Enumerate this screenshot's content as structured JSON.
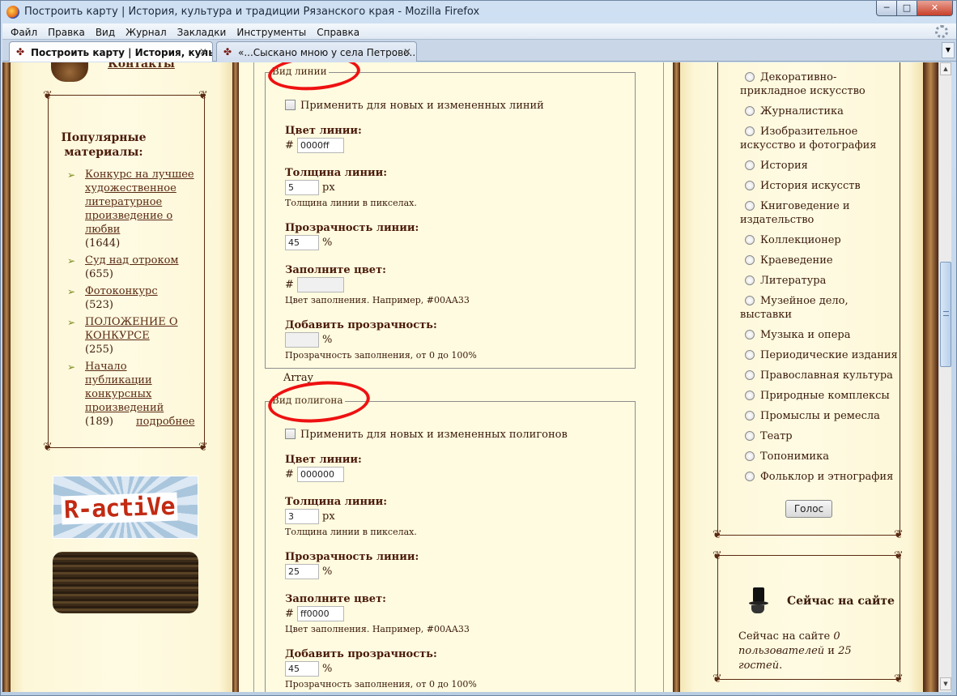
{
  "window": {
    "title": "Построить карту | История, культура и традиции Рязанского края - Mozilla Firefox",
    "min_label": "─",
    "max_label": "□",
    "close_label": "✕"
  },
  "menu": [
    "Файл",
    "Правка",
    "Вид",
    "Журнал",
    "Закладки",
    "Инструменты",
    "Справка"
  ],
  "tabs": [
    {
      "label": "Построить карту | История, куль...",
      "active": true
    },
    {
      "label": "«...Сыскано мною у села Петрово...",
      "active": false
    }
  ],
  "left": {
    "contacts": "Контакты",
    "popular_title": "Популярные материалы:",
    "popular_items": [
      {
        "title": "Конкурс на лучшее художественное литературное произведение о любви",
        "count": "(1644)"
      },
      {
        "title": "Суд над отроком",
        "count": "(655)"
      },
      {
        "title": "Фотоконкурс",
        "count": "(523)"
      },
      {
        "title": "ПОЛОЖЕНИЕ О КОНКУРСЕ",
        "count": "(255)"
      },
      {
        "title": "Начало публикации конкурсных произведений",
        "count": "(189)"
      }
    ],
    "more": "подробнее",
    "banner_text": "R-actiVe"
  },
  "line_style": {
    "legend": "Вид линии",
    "apply_label": "Применить для новых и измененных линий",
    "color_label": "Цвет линии:",
    "color_hash": "#",
    "color_value": "0000ff",
    "width_label": "Толщина линии:",
    "width_value": "5",
    "width_unit": "px",
    "width_hint": "Толщина линии в пикселах.",
    "opacity_label": "Прозрачность линии:",
    "opacity_value": "45",
    "opacity_unit": "%",
    "fill_label": "Заполните цвет:",
    "fill_hash": "#",
    "fill_value": "",
    "fill_hint": "Цвет заполнения. Например, #00AA33",
    "fill_opacity_label": "Добавить прозрачность:",
    "fill_opacity_value": "",
    "fill_opacity_unit": "%",
    "fill_opacity_hint": "Прозрачность заполнения, от 0 до 100%"
  },
  "array_text": "Array",
  "polygon_style": {
    "legend": "Вид полигона",
    "apply_label": "Применить для новых и измененных полигонов",
    "color_label": "Цвет линии:",
    "color_hash": "#",
    "color_value": "000000",
    "width_label": "Толщина линии:",
    "width_value": "3",
    "width_unit": "px",
    "width_hint": "Толщина линии в пикселах.",
    "opacity_label": "Прозрачность линии:",
    "opacity_value": "25",
    "opacity_unit": "%",
    "fill_label": "Заполните цвет:",
    "fill_hash": "#",
    "fill_value": "ff0000",
    "fill_hint": "Цвет заполнения. Например, #00AA33",
    "fill_opacity_label": "Добавить прозрачность:",
    "fill_opacity_value": "45",
    "fill_opacity_unit": "%",
    "fill_opacity_hint": "Прозрачность заполнения, от 0 до 100%"
  },
  "poll": {
    "options": [
      "Декоративно-прикладное искусство",
      "Журналистика",
      "Изобразительное искусство и фотография",
      "История",
      "История искусств",
      "Книговедение и издательство",
      "Коллекционер",
      "Краеведение",
      "Литература",
      "Музейное дело, выставки",
      "Музыка и опера",
      "Периодические издания",
      "Православная культура",
      "Природные комплексы",
      "Промыслы и ремесла",
      "Театр",
      "Топонимика",
      "Фольклор и этнография"
    ],
    "vote_label": "Голос"
  },
  "online": {
    "title": "Сейчас на сайте",
    "text_prefix": "Сейчас на сайте ",
    "users": "0 пользователей",
    "and": " и ",
    "guests": "25 гостей",
    "suffix": "."
  },
  "colors": {
    "highlight_oval": "#ee1111",
    "link": "#5a2a12",
    "paper": "#fffbe0"
  }
}
